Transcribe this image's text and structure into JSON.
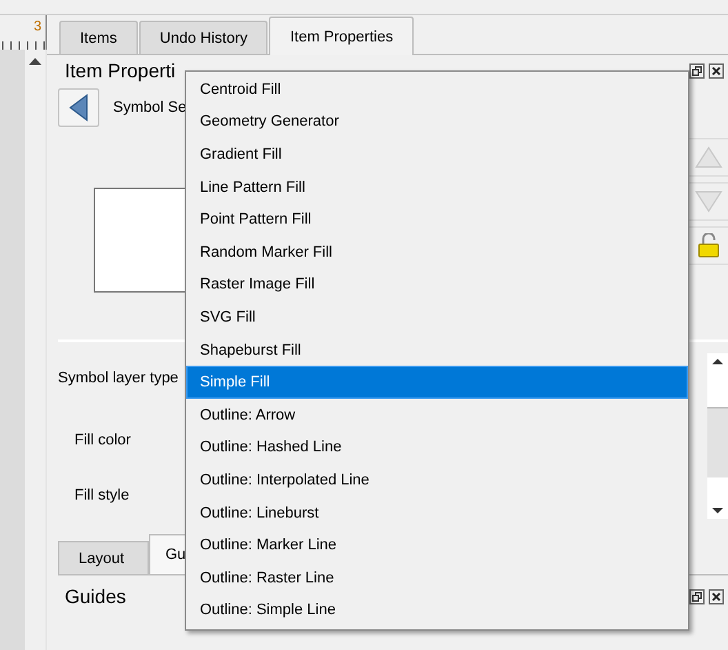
{
  "ruler": {
    "label": "3"
  },
  "tabs": [
    {
      "label": "Items",
      "selected": false
    },
    {
      "label": "Undo History",
      "selected": false
    },
    {
      "label": "Item Properties",
      "selected": true
    }
  ],
  "panel": {
    "title": "Item Properti",
    "back_label": "Symbol Se"
  },
  "form": {
    "layer_type_label": "Symbol layer type",
    "fields": [
      {
        "label": "Fill color"
      },
      {
        "label": "Fill style"
      }
    ]
  },
  "bottom_tabs": [
    {
      "label": "Layout",
      "selected": false
    },
    {
      "label": "Gu",
      "selected": true
    }
  ],
  "guides": {
    "title": "Guides"
  },
  "menu": {
    "items": [
      {
        "label": "Centroid Fill",
        "selected": false
      },
      {
        "label": "Geometry Generator",
        "selected": false
      },
      {
        "label": "Gradient Fill",
        "selected": false
      },
      {
        "label": "Line Pattern Fill",
        "selected": false
      },
      {
        "label": "Point Pattern Fill",
        "selected": false
      },
      {
        "label": "Random Marker Fill",
        "selected": false
      },
      {
        "label": "Raster Image Fill",
        "selected": false
      },
      {
        "label": "SVG Fill",
        "selected": false
      },
      {
        "label": "Shapeburst Fill",
        "selected": false
      },
      {
        "label": "Simple Fill",
        "selected": true
      },
      {
        "label": "Outline: Arrow",
        "selected": false
      },
      {
        "label": "Outline: Hashed Line",
        "selected": false
      },
      {
        "label": "Outline: Interpolated Line",
        "selected": false
      },
      {
        "label": "Outline: Lineburst",
        "selected": false
      },
      {
        "label": "Outline: Marker Line",
        "selected": false
      },
      {
        "label": "Outline: Raster Line",
        "selected": false
      },
      {
        "label": "Outline: Simple Line",
        "selected": false
      }
    ]
  }
}
